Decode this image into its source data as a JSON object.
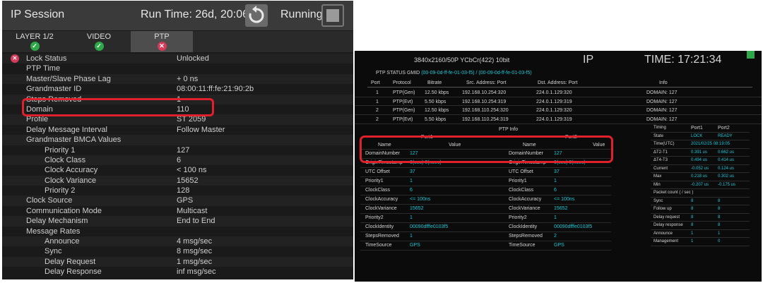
{
  "left": {
    "header": {
      "title": "IP Session",
      "run_time": "Run Time: 26d, 20:06:50",
      "status": "Running"
    },
    "tabs": [
      {
        "label": "LAYER 1/2",
        "state": "ok"
      },
      {
        "label": "VIDEO",
        "state": "ok"
      },
      {
        "label": "PTP",
        "state": "error"
      }
    ],
    "rows": [
      {
        "k": "Lock Status",
        "v": "Unlocked",
        "indent": 0,
        "error": true
      },
      {
        "k": "PTP Time",
        "v": "",
        "indent": 0
      },
      {
        "k": "Master/Slave Phase Lag",
        "v": "+ 0 ns",
        "indent": 0
      },
      {
        "k": "Grandmaster ID",
        "v": "08:00:11:ff:fe:21:90:2b",
        "indent": 0
      },
      {
        "k": "Steps Removed",
        "v": "1",
        "indent": 0
      },
      {
        "k": "Domain",
        "v": "110",
        "indent": 0
      },
      {
        "k": "Profile",
        "v": "ST 2059",
        "indent": 0
      },
      {
        "k": "Delay Message Interval",
        "v": "Follow Master",
        "indent": 0
      },
      {
        "k": "Grandmaster BMCA Values",
        "v": "",
        "indent": 0
      },
      {
        "k": "Priority 1",
        "v": "127",
        "indent": 1
      },
      {
        "k": "Clock Class",
        "v": "6",
        "indent": 1
      },
      {
        "k": "Clock Accuracy",
        "v": "< 100 ns",
        "indent": 1
      },
      {
        "k": "Clock Variance",
        "v": "15652",
        "indent": 1
      },
      {
        "k": "Priority 2",
        "v": "128",
        "indent": 1
      },
      {
        "k": "Clock Source",
        "v": "GPS",
        "indent": 0
      },
      {
        "k": "Communication Mode",
        "v": "Multicast",
        "indent": 0
      },
      {
        "k": "Delay Mechanism",
        "v": "End to End",
        "indent": 0
      },
      {
        "k": "Message Rates",
        "v": "",
        "indent": 0
      },
      {
        "k": "Announce",
        "v": "4 msg/sec",
        "indent": 1
      },
      {
        "k": "Sync",
        "v": "8 msg/sec",
        "indent": 1
      },
      {
        "k": "Delay Request",
        "v": "1 msg/sec",
        "indent": 1
      },
      {
        "k": "Delay Response",
        "v": "inf msg/sec",
        "indent": 1
      }
    ]
  },
  "right": {
    "resolution": "3840x2160/50P YCbCr(422) 10bit",
    "mode": "IP",
    "time": "TIME: 17:21:34",
    "ptp_status_label": "PTP STATUS GMID",
    "ptp_status_value": "(00-09-0d-ff-fe-01-03-f5) / (00-09-0d-ff-fe-01-03-f5)",
    "stream_headers": [
      "Port",
      "Protocol",
      "Bitrate",
      "Src. Address: Port",
      "Dst. Address: Port",
      "Info"
    ],
    "streams": [
      [
        "1",
        "PTP(Gen)",
        "12.50 kbps",
        "192.168.10.254:320",
        "224.0.1.129:320",
        "DOMAIN: 127"
      ],
      [
        "1",
        "PTP(Evt)",
        "5.50 kbps",
        "192.168.10.254:319",
        "224.0.1.129:319",
        "DOMAIN: 127"
      ],
      [
        "2",
        "PTP(Gen)",
        "12.50 kbps",
        "192.168.110.254:320",
        "224.0.1.129:320",
        "DOMAIN: 127"
      ],
      [
        "2",
        "PTP(Evt)",
        "5.50 kbps",
        "192.168.110.254:319",
        "224.0.1.129:319",
        "DOMAIN: 127"
      ]
    ],
    "ptp_info_title": "PTP Info",
    "port1_label": "Port1",
    "port2_label": "Port2",
    "col_name": "Name",
    "col_value": "Value",
    "port_rows": [
      [
        "DomainNumber",
        "127",
        "DomainNumber",
        "127"
      ],
      [
        "OriginTimestamp",
        "0(sec) 0(nsec)",
        "OriginTimestamp",
        "0(sec) 0(nsec)"
      ],
      [
        "UTC Offset",
        "37",
        "UTC Offset",
        "37"
      ],
      [
        "Priority1",
        "1",
        "Priority1",
        "1"
      ],
      [
        "ClockClass",
        "6",
        "ClockClass",
        "6"
      ],
      [
        "ClockAccuracy",
        "<= 100ns",
        "ClockAccuracy",
        "<= 100ns"
      ],
      [
        "ClockVariance",
        "15652",
        "ClockVariance",
        "15652"
      ],
      [
        "Priority2",
        "1",
        "Priority2",
        "1"
      ],
      [
        "ClockIdentity",
        "00090dfffe0103f5",
        "ClockIdentity",
        "00090dfffe0103f5"
      ],
      [
        "StepsRemoved",
        "1",
        "StepsRemoved",
        "2"
      ],
      [
        "TimeSource",
        "GPS",
        "TimeSource",
        "GPS"
      ]
    ],
    "timing_headers": [
      "Timing",
      "Port1",
      "Port2"
    ],
    "timing_rows": [
      [
        "State",
        "LOCK",
        "READY"
      ],
      [
        "Time(UTC)",
        "2021/02/25 08:19:05",
        ""
      ],
      [
        "ΔT2-T1",
        "0.391 us",
        "0.662 us"
      ],
      [
        "ΔT4-T3",
        "0.494 us",
        "0.414 us"
      ],
      [
        "Current",
        "-0.052 us",
        "0.124 us"
      ],
      [
        "Max",
        "0.218 us",
        "0.302 us"
      ],
      [
        "Min",
        "-0.207 us",
        "-0.175 us"
      ]
    ],
    "packet_title": "Packet count ( / sec )",
    "packet_rows": [
      [
        "Sync",
        "8",
        "8"
      ],
      [
        "Follow up",
        "8",
        "8"
      ],
      [
        "Delay request",
        "8",
        "8"
      ],
      [
        "Delay response",
        "8",
        "8"
      ],
      [
        "Announce",
        "1",
        "1"
      ],
      [
        "Management",
        "1",
        "0"
      ]
    ]
  }
}
